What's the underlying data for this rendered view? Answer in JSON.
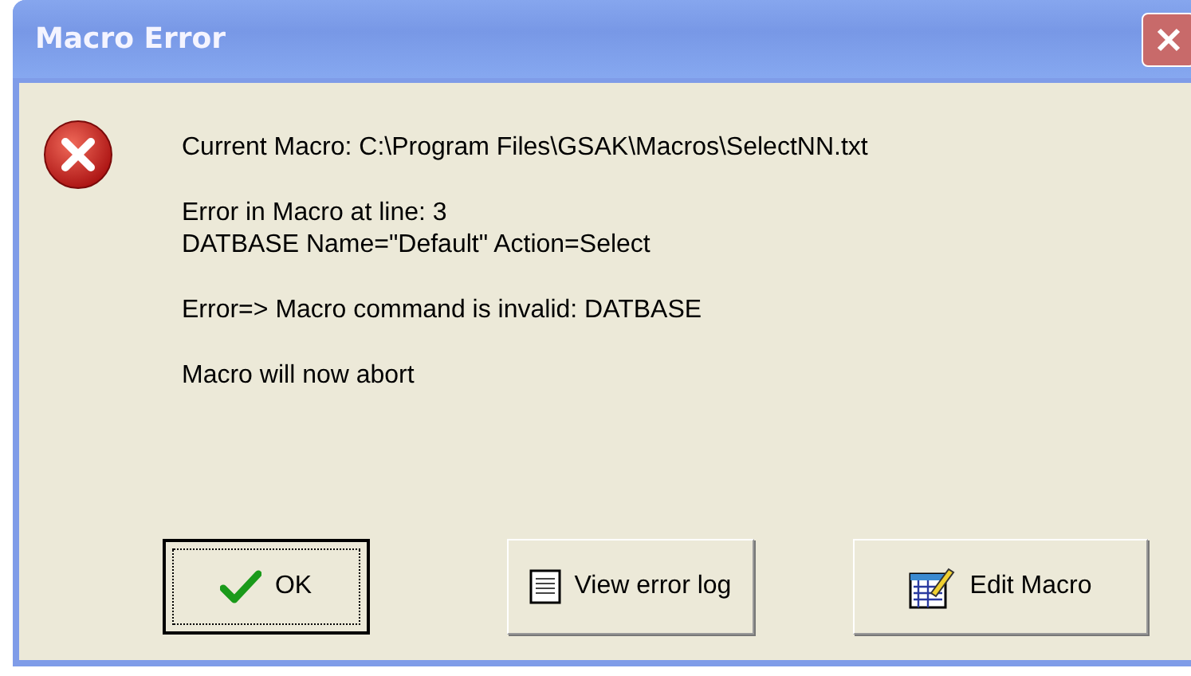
{
  "window": {
    "title": "Macro Error"
  },
  "paragraphs": [
    [
      "Current Macro: C:\\Program Files\\GSAK\\Macros\\SelectNN.txt"
    ],
    [
      "Error in Macro at line: 3",
      "DATBASE Name=\"Default\" Action=Select"
    ],
    [
      "Error=> Macro command is invalid: DATBASE"
    ],
    [
      "Macro will now abort"
    ]
  ],
  "buttons": [
    {
      "label": "OK",
      "kind": "ok",
      "focused": true
    },
    {
      "label": "View error log",
      "kind": "log",
      "focused": false
    },
    {
      "label": "Edit Macro",
      "kind": "edit",
      "focused": false
    }
  ]
}
